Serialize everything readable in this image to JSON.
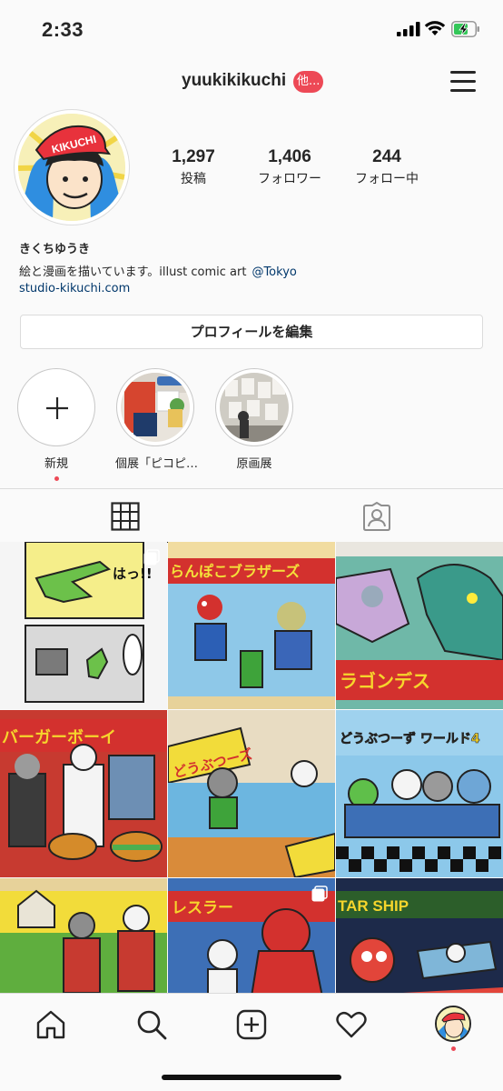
{
  "status_bar": {
    "time": "2:33"
  },
  "header": {
    "username": "yuukikikuchi",
    "badge": "他..."
  },
  "profile": {
    "avatar_cap_text": "KIKUCHI",
    "stats": [
      {
        "value": "1,297",
        "label": "投稿"
      },
      {
        "value": "1,406",
        "label": "フォロワー"
      },
      {
        "value": "244",
        "label": "フォロー中"
      }
    ],
    "display_name": "きくちゆうき",
    "bio": "絵と漫画を描いています。illust comic art",
    "bio_mention": "@Tokyo",
    "website": "studio-kikuchi.com",
    "edit_button": "プロフィールを編集"
  },
  "highlights": [
    {
      "label": "新規",
      "type": "new"
    },
    {
      "label": "個展「ピコピ…",
      "type": "image"
    },
    {
      "label": "原画展",
      "type": "image"
    }
  ],
  "tabs": [
    {
      "name": "grid",
      "icon": "grid-icon",
      "active": true
    },
    {
      "name": "tagged",
      "icon": "tagged-person-icon",
      "active": false
    }
  ],
  "grid_posts": [
    {
      "caption_text": "はっ!!",
      "multi": true
    },
    {
      "caption_text": "らんぽこブラザーズ",
      "multi": false
    },
    {
      "caption_text": "ラゴンデス",
      "multi": false
    },
    {
      "caption_text": "バーガーボーイ",
      "multi": false
    },
    {
      "caption_text": "どうぶつーズ",
      "multi": false
    },
    {
      "caption_text": "どうぶつーず ワールド4",
      "multi": false
    },
    {
      "caption_text": "",
      "multi": false
    },
    {
      "caption_text": "レスラー",
      "multi": true
    },
    {
      "caption_text": "TAR SHIP",
      "multi": false
    }
  ],
  "bottom_nav": [
    "home-icon",
    "search-icon",
    "new-post-icon",
    "activity-heart-icon",
    "profile-avatar-icon"
  ],
  "colors": {
    "badge": "#ed4956",
    "link": "#00376b",
    "border": "#dbdbdb"
  }
}
